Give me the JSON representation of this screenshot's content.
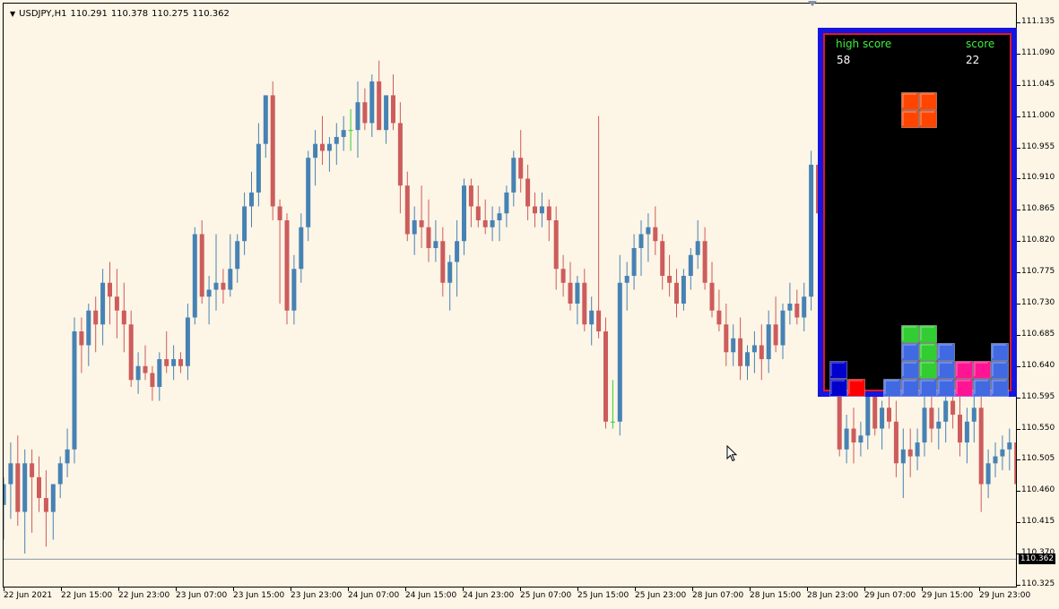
{
  "window": {
    "symbol": "USDJPY,H1",
    "quotes": [
      "110.291",
      "110.378",
      "110.275",
      "110.362"
    ]
  },
  "price_axis": {
    "labels": [
      "111.135",
      "111.090",
      "111.045",
      "111.000",
      "110.955",
      "110.910",
      "110.865",
      "110.820",
      "110.775",
      "110.730",
      "110.685",
      "110.640",
      "110.595",
      "110.550",
      "110.505",
      "110.460",
      "110.415",
      "110.370",
      "110.325"
    ],
    "current_price": "110.362"
  },
  "time_axis": {
    "labels": [
      "22 Jun 2021",
      "22 Jun 15:00",
      "22 Jun 23:00",
      "23 Jun 07:00",
      "23 Jun 15:00",
      "23 Jun 23:00",
      "24 Jun 07:00",
      "24 Jun 15:00",
      "24 Jun 23:00",
      "25 Jun 07:00",
      "25 Jun 15:00",
      "25 Jun 23:00",
      "28 Jun 07:00",
      "28 Jun 15:00",
      "28 Jun 23:00",
      "29 Jun 07:00",
      "29 Jun 15:00",
      "29 Jun 23:00"
    ]
  },
  "colors": {
    "bull": "#4682b4",
    "bear": "#cd5c5c",
    "doji": "#32cd32",
    "background": "#fdf5e6"
  },
  "chart_data": {
    "type": "candlestick",
    "ylim": [
      110.325,
      111.135
    ],
    "candles": [
      [
        110.44,
        110.48,
        110.39,
        110.47
      ],
      [
        110.47,
        110.53,
        110.42,
        110.5
      ],
      [
        110.5,
        110.54,
        110.41,
        110.43
      ],
      [
        110.43,
        110.52,
        110.37,
        110.5
      ],
      [
        110.5,
        110.52,
        110.4,
        110.48
      ],
      [
        110.48,
        110.51,
        110.43,
        110.45
      ],
      [
        110.45,
        110.49,
        110.38,
        110.43
      ],
      [
        110.43,
        110.47,
        110.39,
        110.47
      ],
      [
        110.47,
        110.51,
        110.45,
        110.5
      ],
      [
        110.5,
        110.55,
        110.48,
        110.52
      ],
      [
        110.52,
        110.71,
        110.5,
        110.69
      ],
      [
        110.69,
        110.71,
        110.63,
        110.67
      ],
      [
        110.67,
        110.73,
        110.64,
        110.72
      ],
      [
        110.72,
        110.74,
        110.66,
        110.7
      ],
      [
        110.7,
        110.78,
        110.67,
        110.76
      ],
      [
        110.76,
        110.79,
        110.7,
        110.74
      ],
      [
        110.74,
        110.78,
        110.68,
        110.72
      ],
      [
        110.72,
        110.76,
        110.66,
        110.7
      ],
      [
        110.7,
        110.72,
        110.61,
        110.62
      ],
      [
        110.62,
        110.66,
        110.6,
        110.64
      ],
      [
        110.64,
        110.67,
        110.62,
        110.63
      ],
      [
        110.63,
        110.64,
        110.59,
        110.61
      ],
      [
        110.61,
        110.66,
        110.59,
        110.65
      ],
      [
        110.65,
        110.69,
        110.63,
        110.64
      ],
      [
        110.64,
        110.67,
        110.62,
        110.65
      ],
      [
        110.65,
        110.66,
        110.63,
        110.64
      ],
      [
        110.64,
        110.73,
        110.62,
        110.71
      ],
      [
        110.71,
        110.84,
        110.7,
        110.83
      ],
      [
        110.83,
        110.85,
        110.73,
        110.74
      ],
      [
        110.74,
        110.77,
        110.7,
        110.75
      ],
      [
        110.75,
        110.83,
        110.72,
        110.76
      ],
      [
        110.76,
        110.78,
        110.73,
        110.75
      ],
      [
        110.75,
        110.83,
        110.74,
        110.78
      ],
      [
        110.78,
        110.83,
        110.76,
        110.82
      ],
      [
        110.82,
        110.89,
        110.8,
        110.87
      ],
      [
        110.87,
        110.92,
        110.84,
        110.89
      ],
      [
        110.89,
        110.99,
        110.87,
        110.96
      ],
      [
        110.96,
        111.03,
        110.94,
        111.03
      ],
      [
        111.03,
        111.05,
        110.85,
        110.87
      ],
      [
        110.87,
        110.88,
        110.73,
        110.85
      ],
      [
        110.85,
        110.86,
        110.7,
        110.72
      ],
      [
        110.72,
        110.8,
        110.7,
        110.78
      ],
      [
        110.78,
        110.86,
        110.76,
        110.84
      ],
      [
        110.84,
        110.95,
        110.82,
        110.94
      ],
      [
        110.94,
        110.98,
        110.9,
        110.96
      ],
      [
        110.96,
        111.0,
        110.93,
        110.95
      ],
      [
        110.95,
        110.97,
        110.92,
        110.96
      ],
      [
        110.96,
        110.99,
        110.93,
        110.97
      ],
      [
        110.97,
        111.0,
        110.95,
        110.98
      ],
      [
        110.98,
        111.01,
        110.95,
        110.98
      ],
      [
        110.98,
        111.05,
        110.94,
        111.02
      ],
      [
        111.02,
        111.04,
        110.98,
        110.99
      ],
      [
        110.99,
        111.06,
        110.97,
        111.05
      ],
      [
        111.05,
        111.08,
        110.98,
        110.98
      ],
      [
        110.98,
        111.01,
        110.96,
        111.03
      ],
      [
        111.03,
        111.06,
        110.98,
        110.99
      ],
      [
        110.99,
        111.02,
        110.86,
        110.9
      ],
      [
        110.9,
        110.92,
        110.82,
        110.83
      ],
      [
        110.83,
        110.87,
        110.8,
        110.85
      ],
      [
        110.85,
        110.9,
        110.81,
        110.84
      ],
      [
        110.84,
        110.88,
        110.79,
        110.81
      ],
      [
        110.81,
        110.85,
        110.79,
        110.82
      ],
      [
        110.82,
        110.84,
        110.74,
        110.76
      ],
      [
        110.76,
        110.8,
        110.72,
        110.79
      ],
      [
        110.79,
        110.85,
        110.74,
        110.82
      ],
      [
        110.82,
        110.91,
        110.8,
        110.9
      ],
      [
        110.9,
        110.91,
        110.84,
        110.87
      ],
      [
        110.87,
        110.9,
        110.84,
        110.85
      ],
      [
        110.85,
        110.88,
        110.83,
        110.84
      ],
      [
        110.84,
        110.87,
        110.82,
        110.85
      ],
      [
        110.85,
        110.87,
        110.82,
        110.86
      ],
      [
        110.86,
        110.9,
        110.84,
        110.89
      ],
      [
        110.89,
        110.95,
        110.87,
        110.94
      ],
      [
        110.94,
        110.98,
        110.89,
        110.91
      ],
      [
        110.91,
        110.93,
        110.85,
        110.87
      ],
      [
        110.87,
        110.89,
        110.84,
        110.86
      ],
      [
        110.86,
        110.89,
        110.84,
        110.87
      ],
      [
        110.87,
        110.88,
        110.82,
        110.85
      ],
      [
        110.85,
        110.87,
        110.75,
        110.78
      ],
      [
        110.78,
        110.8,
        110.74,
        110.76
      ],
      [
        110.76,
        110.79,
        110.72,
        110.73
      ],
      [
        110.73,
        110.77,
        110.7,
        110.76
      ],
      [
        110.76,
        110.78,
        110.69,
        110.7
      ],
      [
        110.7,
        110.74,
        110.67,
        110.72
      ],
      [
        110.72,
        111.0,
        110.68,
        110.69
      ],
      [
        110.69,
        110.71,
        110.55,
        110.56
      ],
      [
        110.56,
        110.62,
        110.55,
        110.56
      ],
      [
        110.56,
        110.8,
        110.54,
        110.76
      ],
      [
        110.76,
        110.79,
        110.72,
        110.77
      ],
      [
        110.77,
        110.83,
        110.75,
        110.81
      ],
      [
        110.81,
        110.85,
        110.77,
        110.83
      ],
      [
        110.83,
        110.86,
        110.79,
        110.84
      ],
      [
        110.84,
        110.87,
        110.8,
        110.82
      ],
      [
        110.82,
        110.83,
        110.75,
        110.77
      ],
      [
        110.77,
        110.8,
        110.74,
        110.76
      ],
      [
        110.76,
        110.78,
        110.71,
        110.73
      ],
      [
        110.73,
        110.78,
        110.72,
        110.77
      ],
      [
        110.77,
        110.81,
        110.75,
        110.8
      ],
      [
        110.8,
        110.85,
        110.78,
        110.82
      ],
      [
        110.82,
        110.84,
        110.75,
        110.76
      ],
      [
        110.76,
        110.79,
        110.71,
        110.72
      ],
      [
        110.72,
        110.75,
        110.69,
        110.7
      ],
      [
        110.7,
        110.73,
        110.64,
        110.66
      ],
      [
        110.66,
        110.7,
        110.64,
        110.68
      ],
      [
        110.68,
        110.71,
        110.62,
        110.64
      ],
      [
        110.64,
        110.67,
        110.62,
        110.66
      ],
      [
        110.66,
        110.69,
        110.63,
        110.67
      ],
      [
        110.67,
        110.7,
        110.62,
        110.65
      ],
      [
        110.65,
        110.72,
        110.63,
        110.7
      ],
      [
        110.7,
        110.74,
        110.66,
        110.67
      ],
      [
        110.67,
        110.73,
        110.65,
        110.72
      ],
      [
        110.72,
        110.76,
        110.7,
        110.73
      ],
      [
        110.73,
        110.75,
        110.7,
        110.71
      ],
      [
        110.71,
        110.76,
        110.69,
        110.74
      ],
      [
        110.74,
        110.95,
        110.72,
        110.93
      ],
      [
        110.93,
        110.97,
        110.84,
        110.86
      ],
      [
        110.86,
        110.88,
        110.76,
        110.78
      ],
      [
        110.78,
        110.8,
        110.62,
        110.63
      ],
      [
        110.63,
        110.64,
        110.51,
        110.52
      ],
      [
        110.52,
        110.57,
        110.5,
        110.55
      ],
      [
        110.55,
        110.58,
        110.5,
        110.53
      ],
      [
        110.53,
        110.56,
        110.51,
        110.54
      ],
      [
        110.54,
        110.62,
        110.52,
        110.6
      ],
      [
        110.6,
        110.63,
        110.54,
        110.55
      ],
      [
        110.55,
        110.59,
        110.52,
        110.58
      ],
      [
        110.58,
        110.62,
        110.55,
        110.56
      ],
      [
        110.56,
        110.59,
        110.48,
        110.5
      ],
      [
        110.5,
        110.55,
        110.45,
        110.52
      ],
      [
        110.52,
        110.55,
        110.48,
        110.51
      ],
      [
        110.51,
        110.55,
        110.49,
        110.53
      ],
      [
        110.53,
        110.6,
        110.51,
        110.58
      ],
      [
        110.58,
        110.61,
        110.53,
        110.55
      ],
      [
        110.55,
        110.58,
        110.52,
        110.56
      ],
      [
        110.56,
        110.6,
        110.53,
        110.59
      ],
      [
        110.59,
        110.62,
        110.55,
        110.57
      ],
      [
        110.57,
        110.6,
        110.51,
        110.53
      ],
      [
        110.53,
        110.58,
        110.5,
        110.56
      ],
      [
        110.56,
        110.6,
        110.53,
        110.58
      ],
      [
        110.58,
        110.61,
        110.43,
        110.47
      ],
      [
        110.47,
        110.52,
        110.45,
        110.5
      ],
      [
        110.5,
        110.53,
        110.48,
        110.51
      ],
      [
        110.51,
        110.54,
        110.49,
        110.52
      ],
      [
        110.52,
        110.55,
        110.49,
        110.53
      ],
      [
        110.53,
        110.56,
        110.45,
        110.47
      ],
      [
        110.47,
        110.52,
        110.44,
        110.51
      ],
      [
        110.51,
        110.54,
        110.49,
        110.53
      ],
      [
        110.53,
        110.58,
        110.51,
        110.55
      ]
    ]
  },
  "game": {
    "high_score_label": "high score",
    "high_score": "58",
    "score_label": "score",
    "score": "22",
    "board": {
      "cols": 10,
      "rows": 20,
      "cells": [
        {
          "r": 3,
          "c": 4,
          "col": "#ff4500"
        },
        {
          "r": 3,
          "c": 5,
          "col": "#ff4500"
        },
        {
          "r": 4,
          "c": 4,
          "col": "#ff4500"
        },
        {
          "r": 4,
          "c": 5,
          "col": "#ff4500"
        },
        {
          "r": 16,
          "c": 4,
          "col": "#32cd32"
        },
        {
          "r": 16,
          "c": 5,
          "col": "#32cd32"
        },
        {
          "r": 17,
          "c": 4,
          "col": "#4169e1"
        },
        {
          "r": 17,
          "c": 5,
          "col": "#32cd32"
        },
        {
          "r": 17,
          "c": 6,
          "col": "#4169e1"
        },
        {
          "r": 17,
          "c": 9,
          "col": "#4169e1"
        },
        {
          "r": 18,
          "c": 0,
          "col": "#0000cd"
        },
        {
          "r": 18,
          "c": 4,
          "col": "#4169e1"
        },
        {
          "r": 18,
          "c": 5,
          "col": "#32cd32"
        },
        {
          "r": 18,
          "c": 6,
          "col": "#4169e1"
        },
        {
          "r": 18,
          "c": 7,
          "col": "#ff1493"
        },
        {
          "r": 18,
          "c": 8,
          "col": "#ff1493"
        },
        {
          "r": 18,
          "c": 9,
          "col": "#4169e1"
        },
        {
          "r": 19,
          "c": 0,
          "col": "#0000cd"
        },
        {
          "r": 19,
          "c": 1,
          "col": "#ff0000"
        },
        {
          "r": 19,
          "c": 3,
          "col": "#4169e1"
        },
        {
          "r": 19,
          "c": 4,
          "col": "#4169e1"
        },
        {
          "r": 19,
          "c": 5,
          "col": "#4169e1"
        },
        {
          "r": 19,
          "c": 6,
          "col": "#4169e1"
        },
        {
          "r": 19,
          "c": 7,
          "col": "#ff1493"
        },
        {
          "r": 19,
          "c": 8,
          "col": "#4169e1"
        },
        {
          "r": 19,
          "c": 9,
          "col": "#4169e1"
        }
      ]
    }
  }
}
